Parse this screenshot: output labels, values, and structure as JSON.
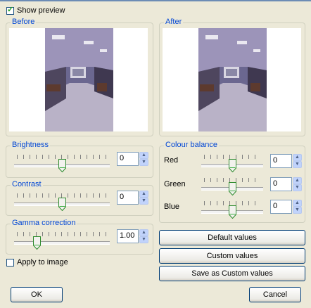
{
  "preview": {
    "label": "Show preview",
    "checked": true
  },
  "before": {
    "title": "Before"
  },
  "after": {
    "title": "After"
  },
  "brightness": {
    "title": "Brightness",
    "value": "0"
  },
  "contrast": {
    "title": "Contrast",
    "value": "0"
  },
  "gamma": {
    "title": "Gamma correction",
    "value": "1.00"
  },
  "apply": {
    "label": "Apply to image",
    "checked": false
  },
  "colour_balance": {
    "title": "Colour balance",
    "red": {
      "label": "Red",
      "value": "0"
    },
    "green": {
      "label": "Green",
      "value": "0"
    },
    "blue": {
      "label": "Blue",
      "value": "0"
    }
  },
  "buttons": {
    "default": "Default values",
    "custom": "Custom values",
    "save_custom": "Save as Custom values",
    "ok": "OK",
    "cancel": "Cancel"
  },
  "colors": {
    "group_title": "#0046D5",
    "background": "#ECE9D8",
    "button_border": "#003C74"
  }
}
